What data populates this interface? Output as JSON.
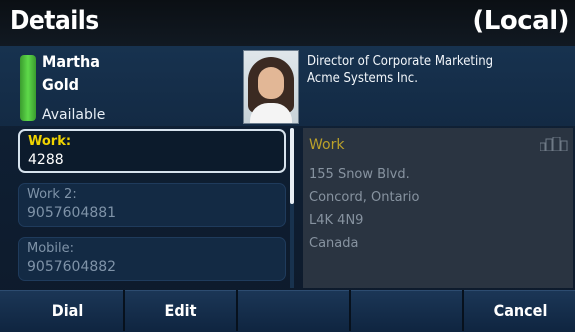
{
  "title": "Details",
  "title_right": "(Local)",
  "contact": {
    "first_name": "Martha",
    "last_name": "Gold",
    "status": "Available",
    "job_title": "Director of Corporate Marketing",
    "company": "Acme Systems Inc."
  },
  "numbers": [
    {
      "label": "Work:",
      "value": "4288",
      "selected": true
    },
    {
      "label": "Work 2:",
      "value": "9057604881",
      "selected": false
    },
    {
      "label": "Mobile:",
      "value": "9057604882",
      "selected": false
    }
  ],
  "address": {
    "title": "Work",
    "lines": [
      "155 Snow Blvd.",
      "Concord, Ontario",
      "L4K 4N9",
      "Canada"
    ]
  },
  "softkeys": [
    "Dial",
    "Edit",
    "",
    "",
    "Cancel"
  ],
  "icons": {
    "presence": "presence-bar",
    "address": "building-icon"
  },
  "colors": {
    "presence_available": "#4cc63a",
    "selected_label": "#f0d400",
    "address_title": "#bba12a"
  }
}
